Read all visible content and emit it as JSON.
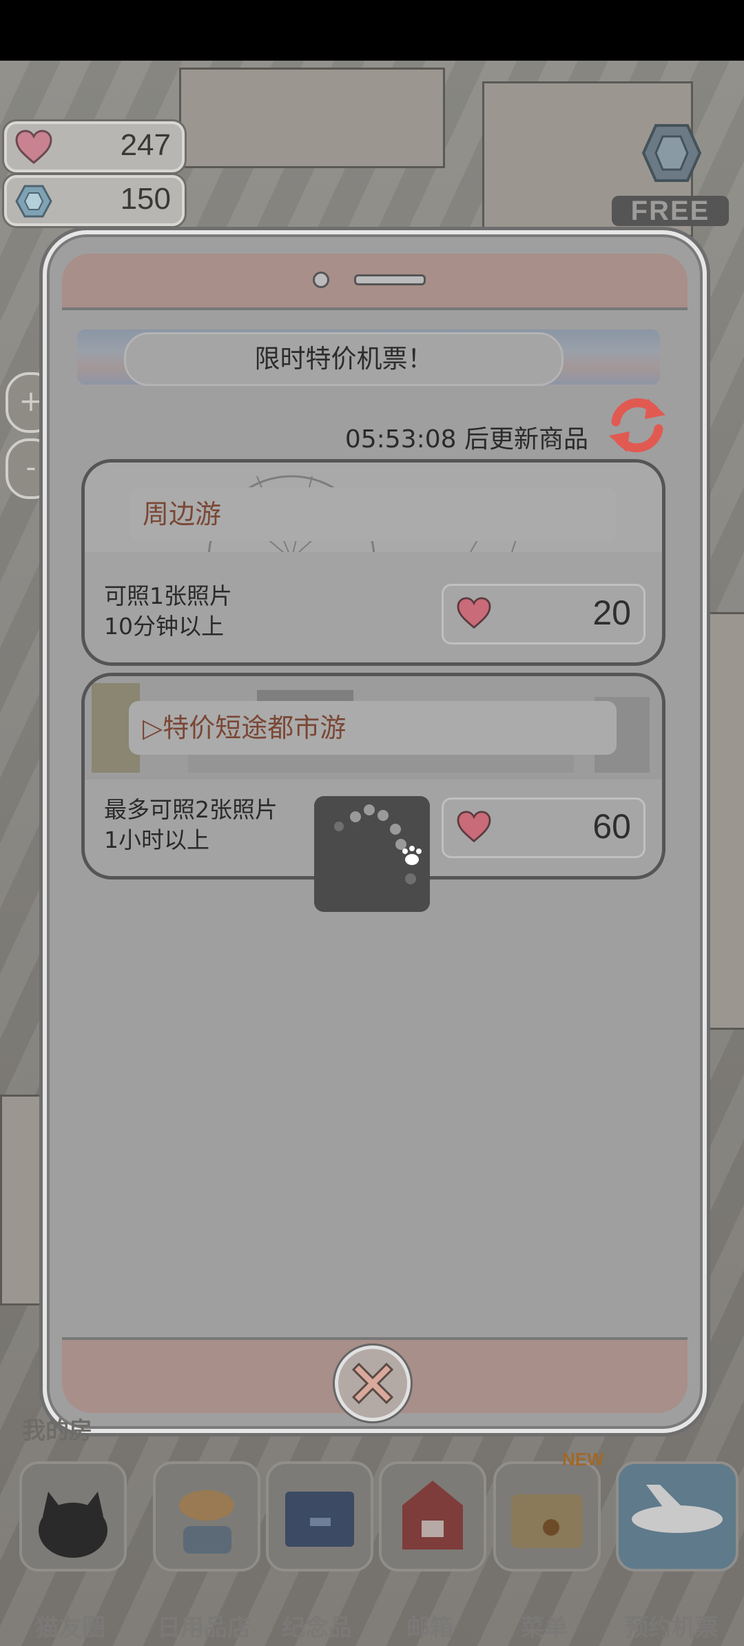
{
  "hud": {
    "hearts": "247",
    "gems": "150",
    "free_label": "FREE",
    "zoom_in": "+",
    "zoom_out": "-"
  },
  "dialog": {
    "title": "限时特价机票！",
    "timer": "05:53:08 后更新商品",
    "tickets": [
      {
        "name": "周边游",
        "desc_line1": "可照1张照片",
        "desc_line2": "10分钟以上",
        "price": "20"
      },
      {
        "name": "▷特价短途都市游",
        "desc_line1": "最多可照2张照片",
        "desc_line2": "1小时以上",
        "price": "60"
      }
    ]
  },
  "dock": {
    "my_room": "我的房",
    "new_badge": "NEW",
    "items": [
      {
        "label": "猫友圈",
        "icon": "cat-face-icon"
      },
      {
        "label": "日用品店",
        "icon": "fish-shop-icon"
      },
      {
        "label": "纪念品",
        "icon": "box-icon"
      },
      {
        "label": "邮箱",
        "icon": "mailbox-icon"
      },
      {
        "label": "菜单",
        "icon": "folder-paw-icon"
      },
      {
        "label": "预约机票",
        "icon": "airplane-icon"
      }
    ]
  },
  "colors": {
    "overlay": "#9f9f9f",
    "accent_red": "#e05a52",
    "heart_pink": "#c96b78",
    "ticket_name": "#7a4735"
  }
}
